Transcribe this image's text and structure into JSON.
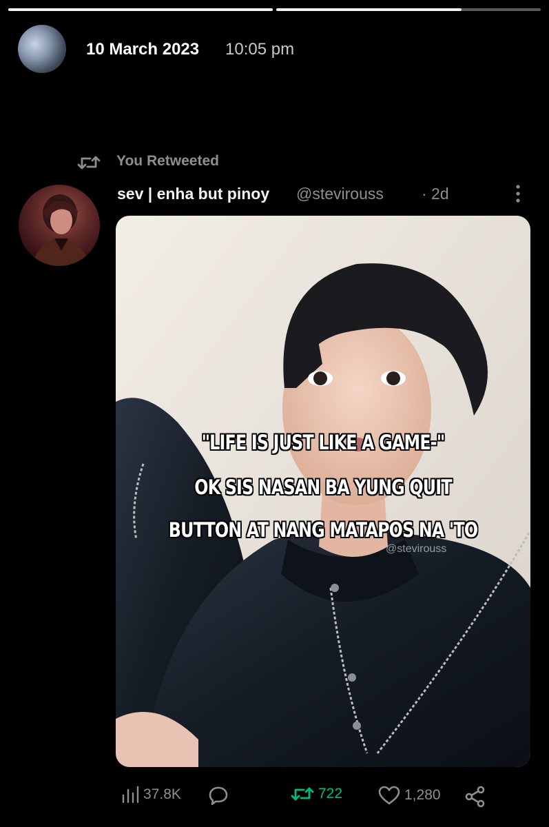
{
  "story": {
    "date": "10 March 2023",
    "time": "10:05 pm",
    "progress_segments": [
      1.0,
      0.7
    ]
  },
  "tweet": {
    "context_label": "You Retweeted",
    "author_name": "sev | enha but pinoy",
    "author_handle": "@stevirouss",
    "age": "· 2d",
    "image_text": {
      "line1": "\"LIFE IS JUST LIKE A GAME-\"",
      "line2": "OK SIS NASAN BA YUNG QUIT",
      "line3": "BUTTON AT NANG MATAPOS NA 'TO",
      "watermark": "@stevirouss"
    },
    "stats": {
      "views": "37.8K",
      "retweets": "722",
      "likes": "1,280"
    }
  },
  "colors": {
    "background": "#000000",
    "muted": "#8b8f94",
    "retweet_active": "#00ba7c"
  },
  "icons": [
    "retweet-icon",
    "more-icon",
    "views-icon",
    "reply-icon",
    "like-icon",
    "share-icon"
  ]
}
